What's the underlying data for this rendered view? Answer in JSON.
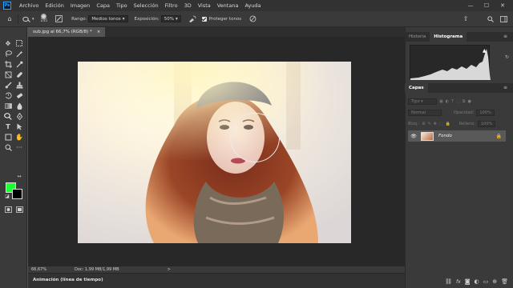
{
  "app": {
    "logo": "Ps"
  },
  "menu": [
    "Archivo",
    "Edición",
    "Imagen",
    "Capa",
    "Tipo",
    "Selección",
    "Filtro",
    "3D",
    "Vista",
    "Ventana",
    "Ayuda"
  ],
  "window_controls": {
    "minimize": "—",
    "maximize": "☐",
    "close": "✕"
  },
  "options_bar": {
    "brush_size": "245",
    "range_label": "Rango:",
    "range_value": "Medios tonos",
    "exposure_label": "Exposición:",
    "exposure_value": "50%",
    "protect_tones_label": "Proteger tonos",
    "protect_tones_checked": true
  },
  "toolbar": {
    "tools": [
      "move-tool",
      "marquee-tool",
      "lasso-tool",
      "magic-wand-tool",
      "crop-tool",
      "frame-tool",
      "eyedropper-tool",
      "heal-tool",
      "brush-tool",
      "stamp-tool",
      "history-brush-tool",
      "eraser-tool",
      "gradient-tool",
      "blur-tool",
      "dodge-tool",
      "pen-tool",
      "type-tool",
      "path-select-tool",
      "shape-tool",
      "hand-tool",
      "zoom-tool",
      "more-tools"
    ],
    "foreground_color": "#1bff35",
    "background_color": "#000000"
  },
  "document": {
    "tab_title": "sub.jpg al 66,7% (RGB/8) *",
    "tab_close": "×",
    "zoom": "66,67%",
    "doc_info": "Doc: 1,99 MB/1,99 MB",
    "status_arrow": ">"
  },
  "timeline": {
    "title": "Animación (línea de tiempo)"
  },
  "panels": {
    "top_tabs": [
      "Historia",
      "Histograma"
    ],
    "active_top_tab": "Histograma",
    "layers_tab": "Capas",
    "filter_kind": "Tipo",
    "blend_mode": "Normal",
    "opacity_label": "Opacidad:",
    "opacity_value": "100%",
    "lock_label": "Bloq.:",
    "fill_label": "Relleno:",
    "fill_value": "100%",
    "layer_name": "Fondo",
    "footer_icons": [
      "link-icon",
      "fx-icon",
      "mask-icon",
      "adjustment-icon",
      "folder-icon",
      "new-layer-icon",
      "trash-icon"
    ]
  }
}
